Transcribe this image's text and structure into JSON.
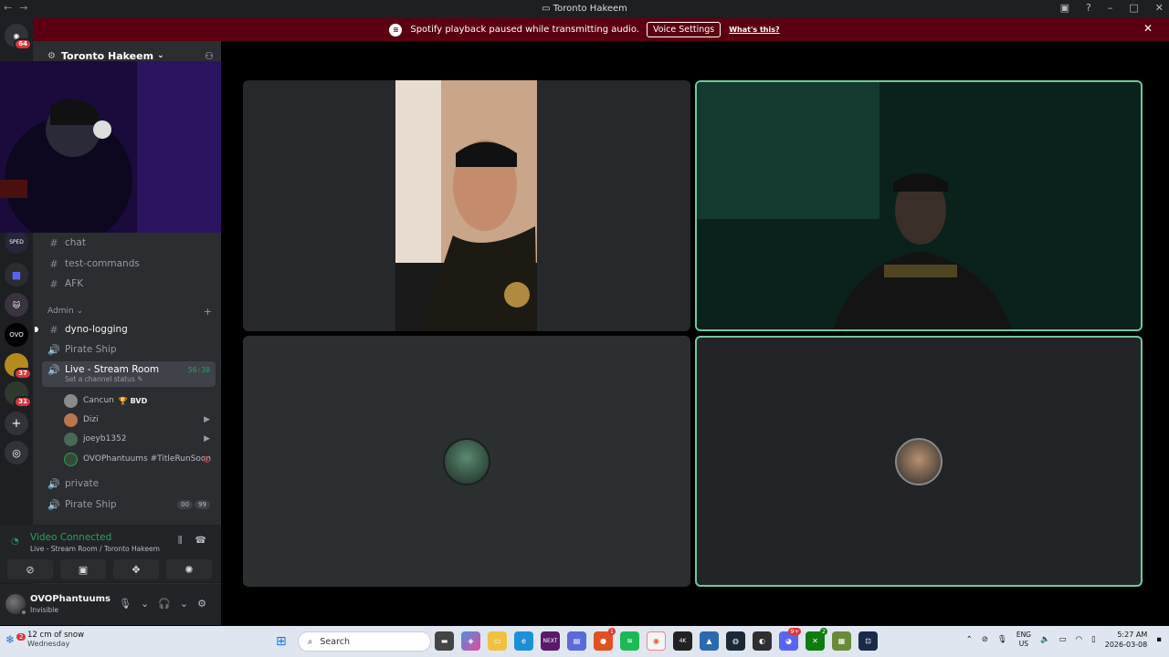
{
  "window": {
    "title": "Toronto Hakeem"
  },
  "banner": {
    "message": "Spotify playback paused while transmitting audio.",
    "button_label": "Voice Settings",
    "link_label": "What's this?"
  },
  "guilds": [
    {
      "name": "discord-home",
      "badge": "64"
    },
    {
      "name": "sped",
      "label": "SPED"
    },
    {
      "name": "folder"
    },
    {
      "name": "cat-server"
    },
    {
      "name": "ovo",
      "label": "OVO"
    },
    {
      "name": "gold-server",
      "badge": "37"
    },
    {
      "name": "server-31",
      "badge": "31"
    }
  ],
  "server": {
    "name": "Toronto Hakeem"
  },
  "channels": {
    "top": [
      {
        "label": "chat",
        "type": "text"
      },
      {
        "label": "test-commands",
        "type": "text"
      },
      {
        "label": "AFK",
        "type": "text"
      }
    ],
    "category_admin": "Admin",
    "admin": [
      {
        "label": "dyno-logging",
        "type": "text"
      },
      {
        "label": "Pirate Ship",
        "type": "voice"
      }
    ],
    "live": {
      "label": "Live - Stream Room",
      "timer": "56:30",
      "status_placeholder": "Set a channel status"
    },
    "members": [
      {
        "name": "Cancun",
        "tag": "🏆 BVD"
      },
      {
        "name": "Dizi"
      },
      {
        "name": "joeyb1352"
      },
      {
        "name": "OVOPhantuums #TitleRunSoon"
      }
    ],
    "bottom": [
      {
        "label": "private",
        "type": "voice"
      },
      {
        "label": "Pirate Ship",
        "type": "voice",
        "pills": [
          "00",
          "99"
        ]
      }
    ]
  },
  "voice": {
    "state": "Video Connected",
    "path": "Live - Stream Room / Toronto Hakeem"
  },
  "user_panel": {
    "name": "OVOPhantuums",
    "status": "Invisible"
  },
  "taskbar": {
    "weather_temp": "12 cm of snow",
    "weather_day": "Wednesday",
    "weather_badge": "2",
    "search_placeholder": "Search",
    "apps": [
      {
        "name": "file-explorer"
      },
      {
        "name": "copilot"
      },
      {
        "name": "folder"
      },
      {
        "name": "edge"
      },
      {
        "name": "next",
        "label": "NEXT"
      },
      {
        "name": "teams"
      },
      {
        "name": "app-badge",
        "badge": "1"
      },
      {
        "name": "spotify"
      },
      {
        "name": "chrome"
      },
      {
        "name": "4k",
        "label": "4K"
      },
      {
        "name": "photos"
      },
      {
        "name": "steam"
      },
      {
        "name": "obs"
      },
      {
        "name": "discord",
        "badge": "9+"
      },
      {
        "name": "xbox",
        "badge": "2"
      },
      {
        "name": "minecraft"
      },
      {
        "name": "other"
      }
    ],
    "lang_top": "ENG",
    "lang_bottom": "US",
    "time": "5:27 AM",
    "date": "2026-03-08"
  },
  "colors": {
    "accent_green": "#23a559",
    "speaking_border": "#6fc99a",
    "banner_bg": "#5b0010",
    "badge_red": "#da373c"
  }
}
